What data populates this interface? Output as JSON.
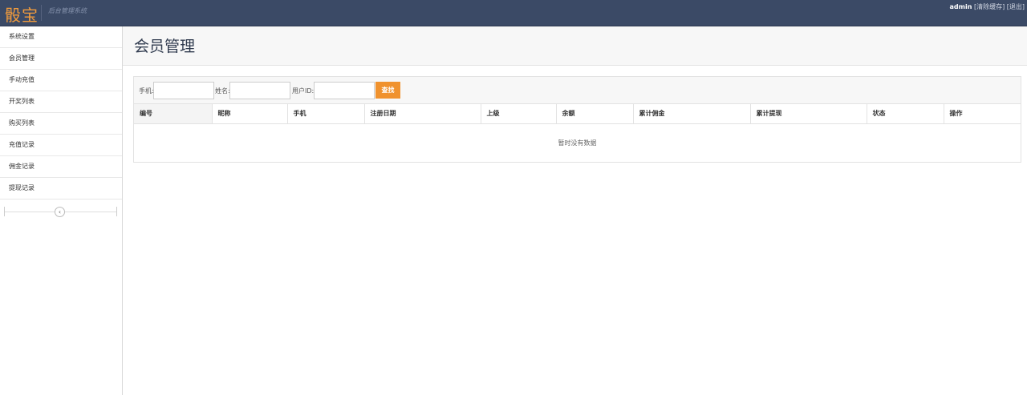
{
  "header": {
    "brand": "骰宝",
    "subtitle": "后台管理系统",
    "user": "admin",
    "clear_cache": "[清除缓存]",
    "logout": "[退出]"
  },
  "sidebar": {
    "items": [
      {
        "label": "系统设置"
      },
      {
        "label": "会员管理"
      },
      {
        "label": "手动充值"
      },
      {
        "label": "开奖列表"
      },
      {
        "label": "购买列表"
      },
      {
        "label": "充值记录"
      },
      {
        "label": "佣金记录"
      },
      {
        "label": "提现记录"
      }
    ],
    "collapse_icon": "chevron-left-icon"
  },
  "main": {
    "title": "会员管理",
    "search": {
      "phone_label": "手机:",
      "phone_value": "",
      "name_label": "姓名:",
      "name_value": "",
      "uid_label": "用户ID:",
      "uid_value": "",
      "button_label": "查找"
    },
    "table": {
      "columns": [
        "编号",
        "昵称",
        "手机",
        "注册日期",
        "上级",
        "余额",
        "累计佣金",
        "累计提现",
        "状态",
        "操作"
      ],
      "empty_text": "暂时没有数据"
    }
  },
  "colors": {
    "navbar": "#3b4a66",
    "brand": "#f39c3c",
    "search_button": "#f0922e"
  }
}
